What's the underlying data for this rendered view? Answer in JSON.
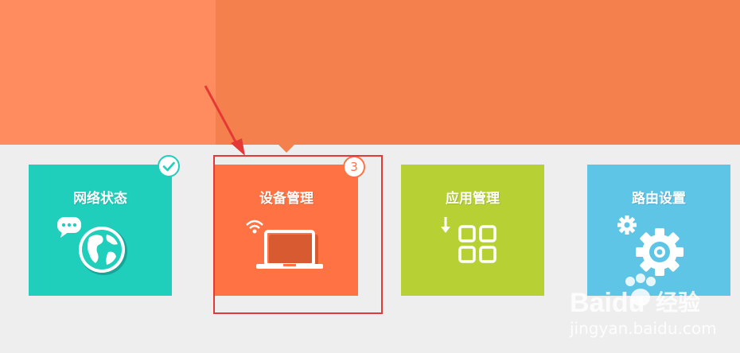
{
  "tiles": {
    "network_status": {
      "label": "网络状态",
      "color": "#1fcfbb",
      "icon": "globe-icon"
    },
    "device_management": {
      "label": "设备管理",
      "color": "#ff7244",
      "icon": "laptop-wifi-icon",
      "badge_count": "3"
    },
    "app_management": {
      "label": "应用管理",
      "color": "#b7d134",
      "icon": "apps-grid-icon"
    },
    "router_settings": {
      "label": "路由设置",
      "color": "#5ec5e6",
      "icon": "gears-icon"
    }
  },
  "header": {
    "color": "#f4804d",
    "left_color": "#ff8c5e"
  },
  "annotation": {
    "frame_color": "#e53935"
  },
  "watermark": {
    "brand": "Baidu",
    "cn": "经验",
    "url": "jingyan.baidu.com"
  }
}
